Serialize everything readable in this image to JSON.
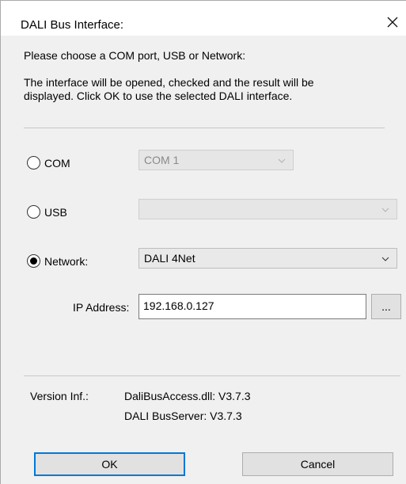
{
  "window": {
    "title": "DALI Bus Interface:"
  },
  "intro": {
    "line1": "Please choose a COM port, USB or Network:",
    "line2": "The interface will be opened, checked and the result will be",
    "line3": "displayed. Click OK to use the selected DALI interface."
  },
  "options": {
    "com": {
      "label": "COM",
      "selected": false,
      "value": "COM 1",
      "enabled": false
    },
    "usb": {
      "label": "USB",
      "selected": false,
      "value": "",
      "enabled": false
    },
    "network": {
      "label": "Network:",
      "selected": true,
      "value": "DALI 4Net",
      "enabled": true
    }
  },
  "ip": {
    "label": "IP Address:",
    "value": "192.168.0.127",
    "browse_label": "..."
  },
  "version": {
    "label": "Version Inf.:",
    "dll": "DaliBusAccess.dll: V3.7.3",
    "server": "DALI BusServer: V3.7.3"
  },
  "buttons": {
    "ok": "OK",
    "cancel": "Cancel"
  },
  "icons": {
    "close": "close-icon",
    "dropdown": "chevron-down-icon"
  }
}
